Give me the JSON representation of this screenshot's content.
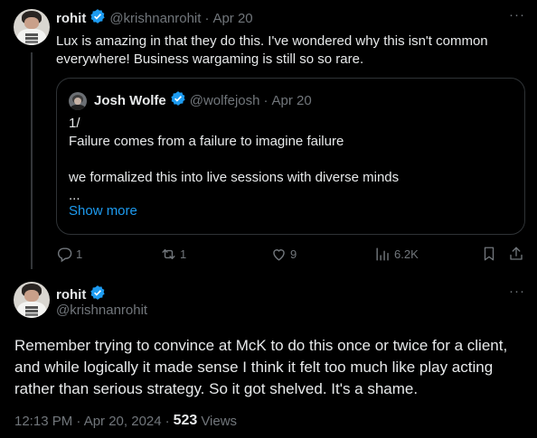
{
  "reply_tweet": {
    "author_name": "rohit",
    "handle": "@krishnanrohit",
    "separator": "·",
    "date": "Apr 20",
    "text": "Lux is amazing in that they do this. I've wondered why this isn't common everywhere! Business wargaming is still so so rare.",
    "more_label": "···"
  },
  "quoted_tweet": {
    "author_name": "Josh Wolfe",
    "handle": "@wolfejosh",
    "separator": "·",
    "date": "Apr 20",
    "text": "1/\nFailure comes from a failure to imagine failure\n\nwe formalized this into live sessions with diverse minds\n...",
    "show_more": "Show more"
  },
  "actions": {
    "replies": "1",
    "retweets": "1",
    "likes": "9",
    "views": "6.2K"
  },
  "main_tweet": {
    "author_name": "rohit",
    "handle": "@krishnanrohit",
    "more_label": "···",
    "text": "Remember trying to convince at McK to do this once or twice for a client, and while logically it made sense I think it felt too much like play acting rather than serious strategy. So it got shelved. It's a shame.",
    "time": "12:13 PM · Apr 20, 2024",
    "separator": "·",
    "views_count": "523",
    "views_label": "Views"
  },
  "colors": {
    "background": "#000000",
    "text": "#e7e9ea",
    "muted": "#71767b",
    "link": "#1d9bf0",
    "verified": "#1d9bf0",
    "border": "#2f3336"
  }
}
